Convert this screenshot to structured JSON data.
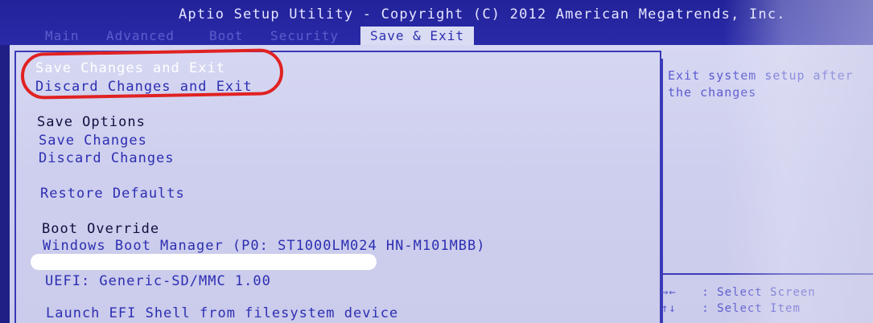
{
  "header": {
    "title": "Aptio Setup Utility - Copyright (C) 2012 American Megatrends, Inc."
  },
  "tabs": [
    "Main",
    "Advanced",
    "Boot",
    "Security",
    "Save & Exit"
  ],
  "active_tab": "Save & Exit",
  "menu": {
    "save_changes_and_exit": "Save Changes and Exit",
    "discard_changes_and_exit": "Discard Changes and Exit",
    "save_options_heading": "Save Options",
    "save_changes": "Save Changes",
    "discard_changes": "Discard Changes",
    "restore_defaults": "Restore Defaults",
    "boot_override_heading": "Boot Override",
    "windows_boot_manager": "Windows Boot Manager (P0: ST1000LM024 HN-M101MBB)",
    "uefi_sd": "UEFI: Generic-SD/MMC 1.00",
    "launch_efi_shell": "Launch EFI Shell from filesystem device"
  },
  "help": {
    "line1": "Exit system setup after",
    "line2": "the changes"
  },
  "keys": [
    {
      "key": "→←",
      "action": ": Select Screen"
    },
    {
      "key": "↑↓",
      "action": ": Select Item"
    }
  ],
  "colors": {
    "bios_blue": "#1f1f86",
    "panel_bg": "#d6d7f2",
    "selected_text": "#ffffff",
    "link_text": "#2c2eb2",
    "annotation_red": "#e02222"
  }
}
